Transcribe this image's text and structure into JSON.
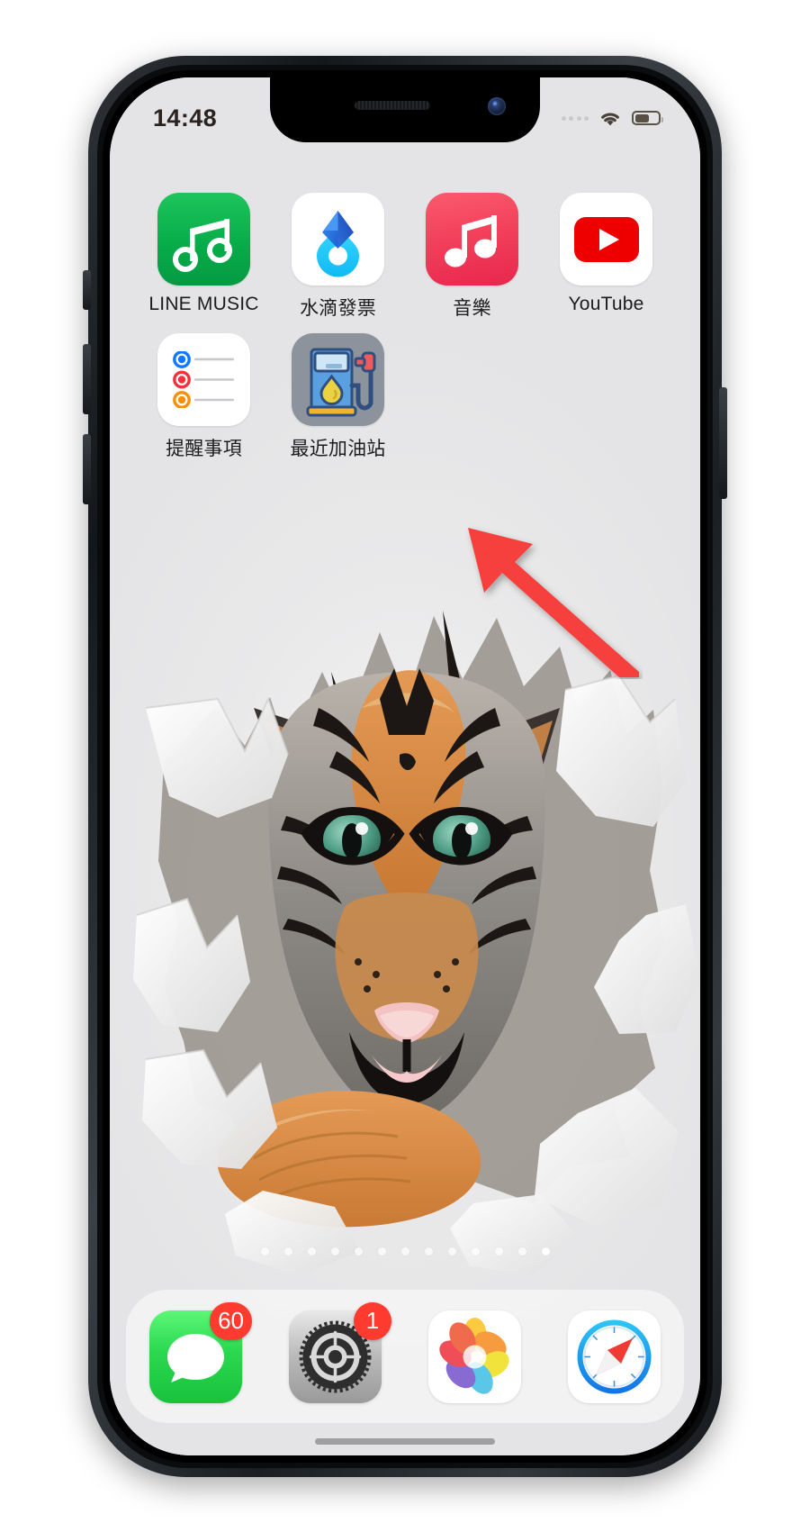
{
  "device": {
    "type": "iphone",
    "orientation": "portrait"
  },
  "status_bar": {
    "time": "14:48",
    "cellular_icon": "signal-dots-icon",
    "wifi_icon": "wifi-icon",
    "battery_icon": "battery-icon"
  },
  "home_screen": {
    "rows": [
      {
        "apps": [
          {
            "label": "LINE MUSIC",
            "icon": "line-music-icon"
          },
          {
            "label": "水滴發票",
            "icon": "water-drop-invoice-icon"
          },
          {
            "label": "音樂",
            "icon": "apple-music-icon"
          },
          {
            "label": "YouTube",
            "icon": "youtube-icon"
          }
        ]
      },
      {
        "apps": [
          {
            "label": "提醒事項",
            "icon": "reminders-icon"
          },
          {
            "label": "最近加油站",
            "icon": "gas-station-icon"
          }
        ]
      }
    ],
    "page_dots": {
      "count": 13,
      "active_index": 12
    },
    "wallpaper": {
      "description": "tiger-bursting-through-torn-paper"
    }
  },
  "annotation": {
    "type": "red-arrow",
    "color": "#f5413e",
    "points_to": "最近加油站",
    "direction": "up-left"
  },
  "dock": {
    "items": [
      {
        "label": "Messages",
        "icon": "messages-icon",
        "badge": "60"
      },
      {
        "label": "Settings",
        "icon": "settings-icon",
        "badge": "1"
      },
      {
        "label": "Photos",
        "icon": "photos-icon",
        "badge": ""
      },
      {
        "label": "Safari",
        "icon": "safari-icon",
        "badge": ""
      }
    ]
  },
  "colors": {
    "badge_red": "#ff3a2f",
    "arrow_red": "#f5413e",
    "line_music_green": "#07ae4a",
    "apple_music_red": "#f2415c",
    "youtube_red": "#ef0000",
    "wallpaper_gray": "#ececed"
  }
}
